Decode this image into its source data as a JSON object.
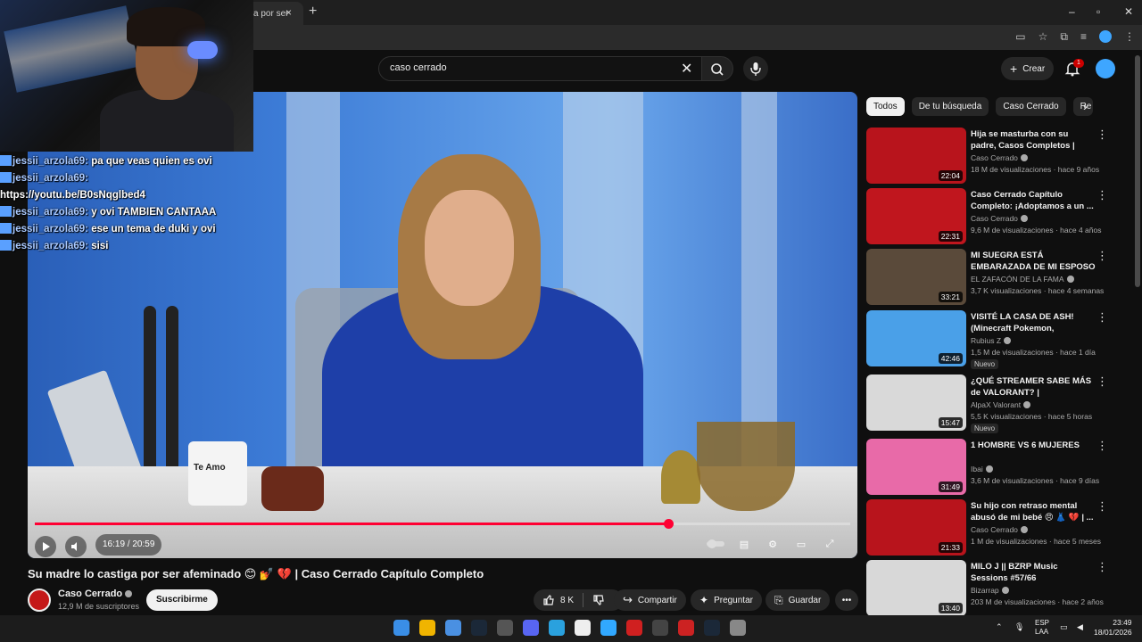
{
  "browser": {
    "tab_title": "a por ser",
    "tab_close": "×",
    "new_tab": "+",
    "window_controls": [
      "–",
      "▫",
      "✕"
    ]
  },
  "youtube": {
    "search_value": "caso cerrado",
    "create_label": "Crear",
    "notification_count": "1"
  },
  "chat": {
    "messages": [
      {
        "user": "jessii_arzola69:",
        "text": "pa que veas quien es ovi"
      },
      {
        "user": "jessii_arzola69:",
        "text": ""
      },
      {
        "user": "",
        "text": "https://youtu.be/B0sNqglbed4"
      },
      {
        "user": "jessii_arzola69:",
        "text": "y ovi TAMBIEN CANTAAA"
      },
      {
        "user": "jessii_arzola69:",
        "text": "ese un tema de duki y ovi"
      },
      {
        "user": "jessii_arzola69:",
        "text": "sisi"
      }
    ]
  },
  "player": {
    "time": "16:19 / 20:59",
    "progress": 0.777,
    "mug_text": "Te Amo"
  },
  "video": {
    "title": "Su madre lo castiga por ser afeminado 😊 💅 💔 | Caso Cerrado Capítulo Completo",
    "channel": "Caso Cerrado",
    "subscribers": "12,9 M de suscriptores",
    "subscribe_label": "Suscribirme",
    "likes": "8 K",
    "share_label": "Compartir",
    "ask_label": "Preguntar",
    "save_label": "Guardar",
    "more_label": "•••"
  },
  "sidebar": {
    "chips": [
      "Todos",
      "De tu búsqueda",
      "Caso Cerrado",
      "Re"
    ],
    "items": [
      {
        "title": "Hija se masturba con su padre, Casos Completos | Caso ...",
        "channel": "Caso Cerrado",
        "meta": "18 M de visualizaciones · hace 9 años",
        "duration": "22:04",
        "badge": "",
        "thumb_color": "#b8141c"
      },
      {
        "title": "Caso Cerrado Capítulo Completo: ¡Adoptamos a un ...",
        "channel": "Caso Cerrado",
        "meta": "9,6 M de visualizaciones · hace 4 años",
        "duration": "22:31",
        "badge": "",
        "thumb_color": "#c0161e"
      },
      {
        "title": "MI SUEGRA ESTÁ EMBARAZADA DE MI ESPOSO El secreto que ...",
        "channel": "EL ZAFACÓN DE LA FAMA",
        "meta": "3,7 K visualizaciones · hace 4 semanas",
        "duration": "33:21",
        "badge": "",
        "thumb_color": "#5a4a3a"
      },
      {
        "title": "VISITÉ LA CASA DE ASH! (Minecraft Pokemon, Episodio...",
        "channel": "Rubius Z",
        "meta": "1,5 M de visualizaciones · hace 1 día",
        "duration": "42:46",
        "badge": "Nuevo",
        "thumb_color": "#4aa0e8"
      },
      {
        "title": "¿QUÉ STREAMER SABE MÁS de VALORANT? | PASAPALABRA",
        "channel": "AlpaX Valorant",
        "meta": "5,5 K visualizaciones · hace 5 horas",
        "duration": "15:47",
        "badge": "Nuevo",
        "thumb_color": "#d9d9d9"
      },
      {
        "title": "1 HOMBRE VS 6 MUJERES",
        "channel": "Ibai",
        "meta": "3,6 M de visualizaciones · hace 9 días",
        "duration": "31:49",
        "badge": "",
        "thumb_color": "#e86aa8"
      },
      {
        "title": "Su hijo con retraso mental abusó de mi bebé 😠 👗 💔 | ...",
        "channel": "Caso Cerrado",
        "meta": "1 M de visualizaciones · hace 5 meses",
        "duration": "21:33",
        "badge": "",
        "thumb_color": "#b8141c"
      },
      {
        "title": "MILO J || BZRP Music Sessions #57/66",
        "channel": "Bizarrap",
        "meta": "203 M de visualizaciones · hace 2 años",
        "duration": "13:40",
        "badge": "",
        "thumb_color": "#d8d8d8"
      }
    ]
  },
  "taskbar": {
    "lang": "ESP",
    "lang_sub": "LAA",
    "time": "23:49",
    "date": "18/01/2026",
    "icon_colors": [
      "#3a8ee6",
      "#f0b400",
      "#4a90e2",
      "#1b2838",
      "#555555",
      "#5865f2",
      "#2aa1de",
      "#eeeeee",
      "#31a8ff",
      "#d02020",
      "#444444",
      "#cc2222",
      "#1b2838",
      "#888888"
    ]
  }
}
